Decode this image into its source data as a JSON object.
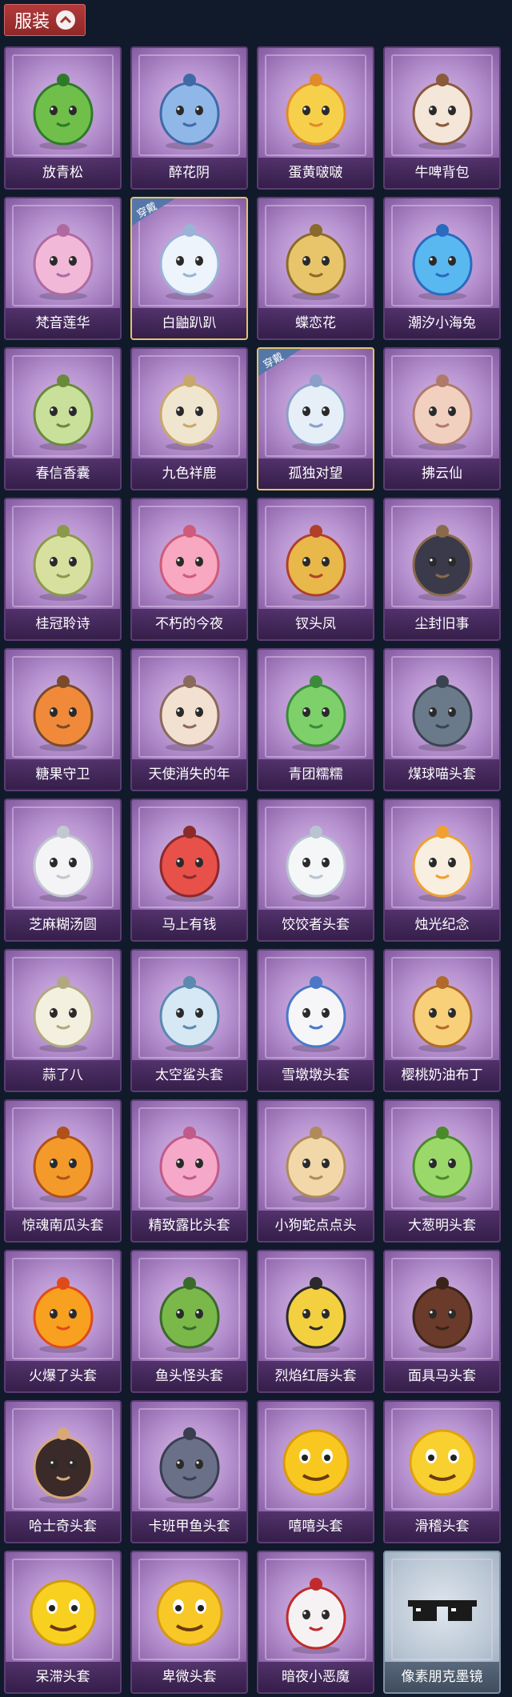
{
  "section": {
    "label": "服装",
    "icon": "chevron-up-icon"
  },
  "accent_colors": {
    "tab": "#a93232",
    "card": "#b691cf",
    "equipped_border": "#e6c26a"
  },
  "items": [
    {
      "name": "放青松",
      "icon": "bonsai-tree-icon",
      "equipped": false
    },
    {
      "name": "醉花阴",
      "icon": "flower-dreamcatcher-icon",
      "equipped": false
    },
    {
      "name": "蛋黄啵啵",
      "icon": "egg-chick-icon",
      "equipped": false
    },
    {
      "name": "牛啤背包",
      "icon": "cow-barrel-icon",
      "equipped": false
    },
    {
      "name": "梵音莲华",
      "icon": "lotus-doll-icon",
      "equipped": false
    },
    {
      "name": "白鼬趴趴",
      "icon": "white-ermine-icon",
      "equipped": true,
      "badge": "穿戴"
    },
    {
      "name": "蝶恋花",
      "icon": "butterfly-bell-icon",
      "equipped": false
    },
    {
      "name": "潮汐小海兔",
      "icon": "sea-bunny-icon",
      "equipped": false
    },
    {
      "name": "春信香囊",
      "icon": "sachet-icon",
      "equipped": false
    },
    {
      "name": "九色祥鹿",
      "icon": "deer-icon",
      "equipped": false
    },
    {
      "name": "孤独对望",
      "icon": "moon-doll-icon",
      "equipped": true,
      "badge": "穿戴"
    },
    {
      "name": "拂云仙",
      "icon": "cloud-fairy-icon",
      "equipped": false
    },
    {
      "name": "桂冠聆诗",
      "icon": "laurel-doll-icon",
      "equipped": false
    },
    {
      "name": "不朽的今夜",
      "icon": "pink-cat-cup-icon",
      "equipped": false
    },
    {
      "name": "钗头凤",
      "icon": "phoenix-crown-icon",
      "equipped": false
    },
    {
      "name": "尘封旧事",
      "icon": "dark-hair-boy-icon",
      "equipped": false
    },
    {
      "name": "糖果守卫",
      "icon": "pumpkin-scarecrow-icon",
      "equipped": false
    },
    {
      "name": "天使消失的年",
      "icon": "angel-girl-icon",
      "equipped": false
    },
    {
      "name": "青团糯糯",
      "icon": "green-rice-ball-icon",
      "equipped": false
    },
    {
      "name": "煤球喵头套",
      "icon": "gray-cat-head-icon",
      "equipped": false
    },
    {
      "name": "芝麻糊汤圆",
      "icon": "rice-dumpling-icon",
      "equipped": false
    },
    {
      "name": "马上有钱",
      "icon": "red-horse-icon",
      "equipped": false
    },
    {
      "name": "饺饺者头套",
      "icon": "dumpling-head-icon",
      "equipped": false
    },
    {
      "name": "烛光纪念",
      "icon": "candle-icon",
      "equipped": false
    },
    {
      "name": "蒜了八",
      "icon": "garlic-icon",
      "equipped": false
    },
    {
      "name": "太空鲨头套",
      "icon": "shark-head-icon",
      "equipped": false
    },
    {
      "name": "雪墩墩头套",
      "icon": "snowman-head-icon",
      "equipped": false
    },
    {
      "name": "樱桃奶油布丁",
      "icon": "pudding-icon",
      "equipped": false
    },
    {
      "name": "惊魂南瓜头套",
      "icon": "jack-o-lantern-icon",
      "equipped": false
    },
    {
      "name": "精致露比头套",
      "icon": "pink-pig-glasses-icon",
      "equipped": false
    },
    {
      "name": "小狗蛇点点头",
      "icon": "snake-icon",
      "equipped": false
    },
    {
      "name": "大葱明头套",
      "icon": "scallion-head-icon",
      "equipped": false
    },
    {
      "name": "火爆了头套",
      "icon": "fire-head-icon",
      "equipped": false
    },
    {
      "name": "鱼头怪头套",
      "icon": "fish-head-icon",
      "equipped": false
    },
    {
      "name": "烈焰红唇头套",
      "icon": "yellow-mouse-sunglasses-icon",
      "equipped": false
    },
    {
      "name": "面具马头套",
      "icon": "horse-mask-icon",
      "equipped": false
    },
    {
      "name": "哈士奇头套",
      "icon": "husky-sunglasses-icon",
      "equipped": false
    },
    {
      "name": "卡班甲鱼头套",
      "icon": "whale-head-icon",
      "equipped": false
    },
    {
      "name": "嘻嘻头套",
      "icon": "grin-emoji-icon",
      "equipped": false
    },
    {
      "name": "滑稽头套",
      "icon": "funny-emoji-icon",
      "equipped": false
    },
    {
      "name": "呆滞头套",
      "icon": "stunned-emoji-icon",
      "equipped": false
    },
    {
      "name": "卑微头套",
      "icon": "pleading-emoji-icon",
      "equipped": false
    },
    {
      "name": "暗夜小恶魔",
      "icon": "little-devil-icon",
      "equipped": false
    },
    {
      "name": "像素朋克墨镜",
      "icon": "pixel-sunglasses-icon",
      "equipped": false,
      "style": "light"
    }
  ]
}
